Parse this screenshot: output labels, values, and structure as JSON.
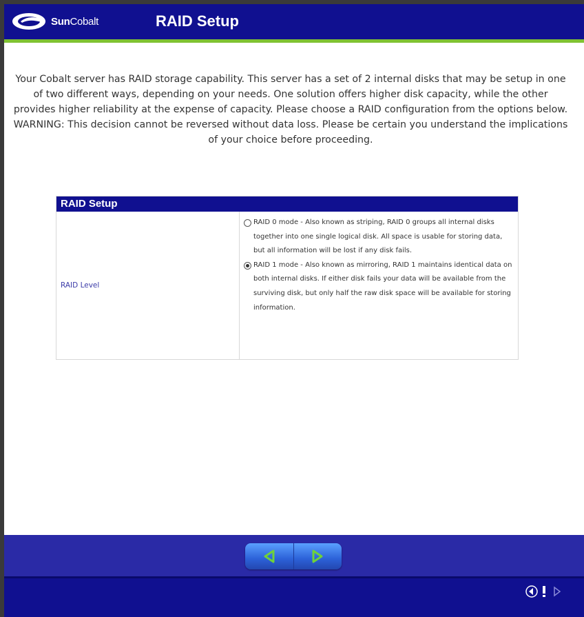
{
  "header": {
    "logo_text_bold": "Sun",
    "logo_text_regular": "Cobalt",
    "logo_icon": "cobalt-swoosh-icon",
    "title": "RAID Setup"
  },
  "intro": {
    "text": "Your Cobalt server has RAID storage capability. This server has a set of 2 internal disks that may be setup in one of two different ways, depending on your needs. One solution offers higher disk capacity, while the other provides higher reliability at the expense of capacity. Please choose a RAID configuration from the options below. WARNING: This decision cannot be reversed without data loss. Please be certain you understand the implications of your choice before proceeding."
  },
  "raid_table": {
    "header": "RAID Setup",
    "field_label": "RAID Level",
    "options": [
      {
        "text": "RAID 0 mode - Also known as striping, RAID 0 groups all internal disks together into one single logical disk. All space is usable for storing data, but all information will be lost if any disk fails.",
        "selected": false
      },
      {
        "text": "RAID 1 mode - Also known as mirroring, RAID 1 maintains identical data on both internal disks. If either disk fails your data will be available from the surviving disk, but only half the raw disk space will be available for storing information.",
        "selected": true
      }
    ]
  },
  "footer": {
    "back_icon": "arrow-left-icon",
    "next_icon": "arrow-right-icon",
    "corner_icons": [
      "small-left-arrow-icon",
      "exclamation-icon",
      "small-right-arrow-icon"
    ]
  },
  "colors": {
    "header_bg": "#101090",
    "accent_line": "#7fc232",
    "label_blue": "#3b3ba8",
    "nav_arrow_green": "#6fd13a"
  }
}
